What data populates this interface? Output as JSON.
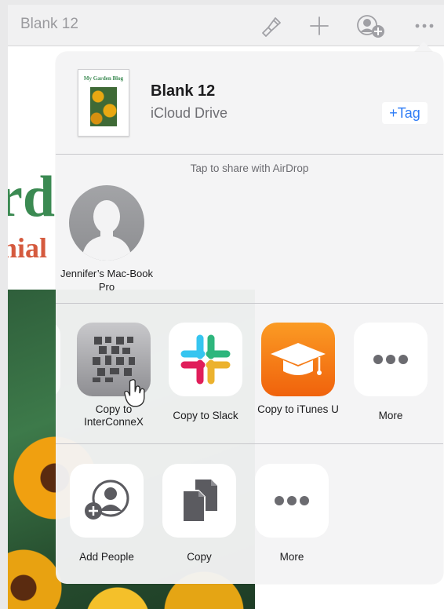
{
  "toolbar": {
    "document_title": "Blank 12",
    "icons": [
      "paintbrush-icon",
      "plus-icon",
      "add-person-icon",
      "more-icon"
    ]
  },
  "document": {
    "heading_fragment_1": "rd",
    "heading_fragment_2": "nial"
  },
  "share_sheet": {
    "file_thumbnail_title": "My Garden Blog",
    "file_name": "Blank 12",
    "file_location": "iCloud Drive",
    "tag_button": "+Tag",
    "airdrop_hint": "Tap to share with AirDrop",
    "airdrop_contacts": [
      {
        "name": "Jennifer’s Mac-Book Pro",
        "icon": "person-silhouette-icon"
      }
    ],
    "apps": [
      {
        "label": "Copy to InterConneX",
        "icon": "interconnex-icon"
      },
      {
        "label": "Copy to Slack",
        "icon": "slack-icon"
      },
      {
        "label": "Copy to iTunes U",
        "icon": "itunes-u-icon"
      },
      {
        "label": "More",
        "icon": "more-dots-icon"
      }
    ],
    "actions": [
      {
        "label": "Add People",
        "icon": "add-people-icon"
      },
      {
        "label": "Copy",
        "icon": "copy-icon"
      },
      {
        "label": "More",
        "icon": "more-dots-icon"
      }
    ]
  },
  "colors": {
    "accent_blue": "#2e7cf6",
    "itunes_u_orange": "#f57a14",
    "heading_green": "#3b8a52",
    "heading_red": "#d55a3e"
  }
}
